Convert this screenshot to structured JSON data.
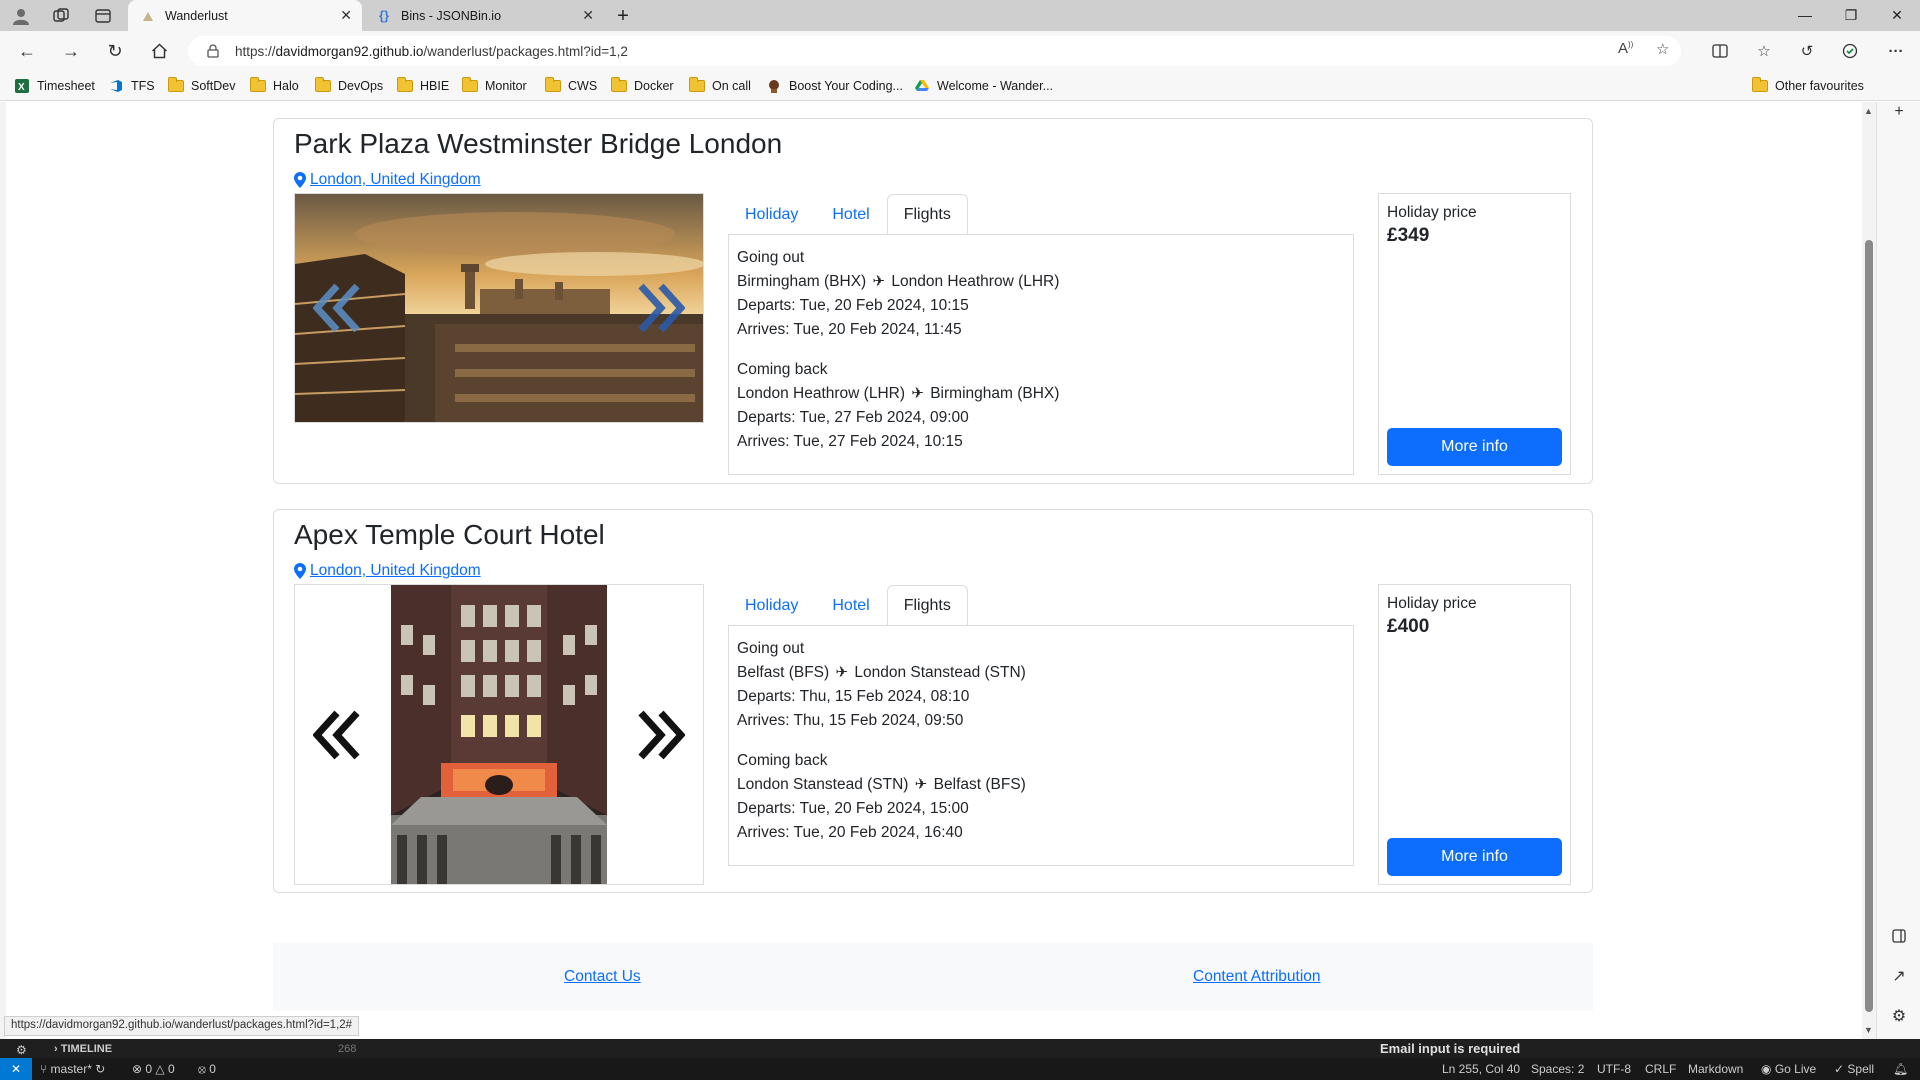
{
  "browser": {
    "tabs": [
      {
        "title": "Wanderlust",
        "active": true
      },
      {
        "title": "Bins - JSONBin.io",
        "active": false
      }
    ],
    "new_tab_label": "+",
    "url_prefix": "https://",
    "url_host": "davidmorgan92.github.io",
    "url_path": "/wanderlust/packages.html?id=1,2",
    "favourites": [
      {
        "label": "Timesheet",
        "icon": "excel-icon"
      },
      {
        "label": "TFS",
        "icon": "azure-devops-icon"
      },
      {
        "label": "SoftDev",
        "icon": "folder-icon"
      },
      {
        "label": "Halo",
        "icon": "folder-icon"
      },
      {
        "label": "DevOps",
        "icon": "folder-icon"
      },
      {
        "label": "HBIE",
        "icon": "folder-icon"
      },
      {
        "label": "Monitor",
        "icon": "folder-icon"
      },
      {
        "label": "CWS",
        "icon": "folder-icon"
      },
      {
        "label": "Docker",
        "icon": "folder-icon"
      },
      {
        "label": "On call",
        "icon": "folder-icon"
      },
      {
        "label": "Boost Your Coding...",
        "icon": "site-icon"
      },
      {
        "label": "Welcome - Wander...",
        "icon": "google-drive-icon"
      }
    ],
    "other_favourites": "Other favourites",
    "status_url": "https://davidmorgan92.github.io/wanderlust/packages.html?id=1,2#"
  },
  "packages": [
    {
      "title": "Park Plaza Westminster Bridge London",
      "location": "London, United Kingdom",
      "tabs": [
        "Holiday",
        "Hotel",
        "Flights"
      ],
      "active_tab": "Flights",
      "outbound": {
        "heading": "Going out",
        "from": "Birmingham (BHX)",
        "to": "London Heathrow (LHR)",
        "departs": "Departs: Tue, 20 Feb 2024, 10:15",
        "arrives": "Arrives: Tue, 20 Feb 2024, 11:45"
      },
      "inbound": {
        "heading": "Coming back",
        "from": "London Heathrow (LHR)",
        "to": "Birmingham (BHX)",
        "departs": "Departs: Tue, 27 Feb 2024, 09:00",
        "arrives": "Arrives: Tue, 27 Feb 2024, 10:15"
      },
      "price_label": "Holiday price",
      "price": "£349",
      "more_info": "More info"
    },
    {
      "title": "Apex Temple Court Hotel",
      "location": "London, United Kingdom",
      "tabs": [
        "Holiday",
        "Hotel",
        "Flights"
      ],
      "active_tab": "Flights",
      "outbound": {
        "heading": "Going out",
        "from": "Belfast (BFS)",
        "to": "London Stanstead (STN)",
        "departs": "Departs: Thu, 15 Feb 2024, 08:10",
        "arrives": "Arrives: Thu, 15 Feb 2024, 09:50"
      },
      "inbound": {
        "heading": "Coming back",
        "from": "London Stanstead (STN)",
        "to": "Belfast (BFS)",
        "departs": "Departs: Tue, 20 Feb 2024, 15:00",
        "arrives": "Arrives: Tue, 20 Feb 2024, 16:40"
      },
      "price_label": "Holiday price",
      "price": "£400",
      "more_info": "More info"
    }
  ],
  "footer": {
    "contact": "Contact Us",
    "attribution": "Content Attribution"
  },
  "vscode": {
    "timeline": "TIMELINE",
    "line_number": "268",
    "notification": "Email input is required",
    "branch": "master*",
    "errors": "0",
    "warnings": "0",
    "ports": "0",
    "cursor": "Ln 255, Col 40",
    "spaces": "Spaces: 2",
    "encoding": "UTF-8",
    "eol": "CRLF",
    "language": "Markdown",
    "go_live": "Go Live",
    "spell": "Spell"
  },
  "colors": {
    "link": "#0d6efd",
    "primary_button": "#0d6efd",
    "vscode_remote": "#0078d4"
  }
}
